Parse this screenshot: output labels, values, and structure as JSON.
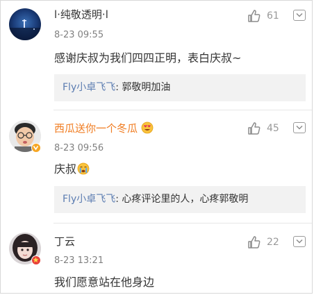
{
  "comments": [
    {
      "username": "l·纯敬透明·l",
      "time": "8-23 09:55",
      "likes": "61",
      "text": "感谢庆叔为我们四四正明，表白庆叔~",
      "reply": {
        "user": "Fly小卓飞飞",
        "separator": ": ",
        "text": "郭敬明加油"
      },
      "name_color": "#333333",
      "badge": "none"
    },
    {
      "username": "西瓜送你一个冬瓜",
      "username_emoji": "heart-eyes-emoji",
      "time": "8-23 09:56",
      "likes": "45",
      "text": "庆叔",
      "text_emoji": "crying-emoji",
      "reply": {
        "user": "Fly小卓飞飞",
        "separator": ": ",
        "text": "心疼评论里的人，心疼郭敬明"
      },
      "name_color": "#f07b1f",
      "badge": "orange-v-badge"
    },
    {
      "username": "丁云",
      "time": "8-23 13:21",
      "likes": "22",
      "text": "我们愿意站在他身边",
      "name_color": "#333333",
      "badge": "red-star-badge"
    }
  ],
  "icons": {
    "like": "thumbs-up-icon",
    "more": "chevron-down-icon"
  },
  "colors": {
    "reply_user": "#5b7cb1",
    "reply_bg": "#f2f2f2",
    "meta": "#808080",
    "vip_name": "#f07b1f"
  }
}
